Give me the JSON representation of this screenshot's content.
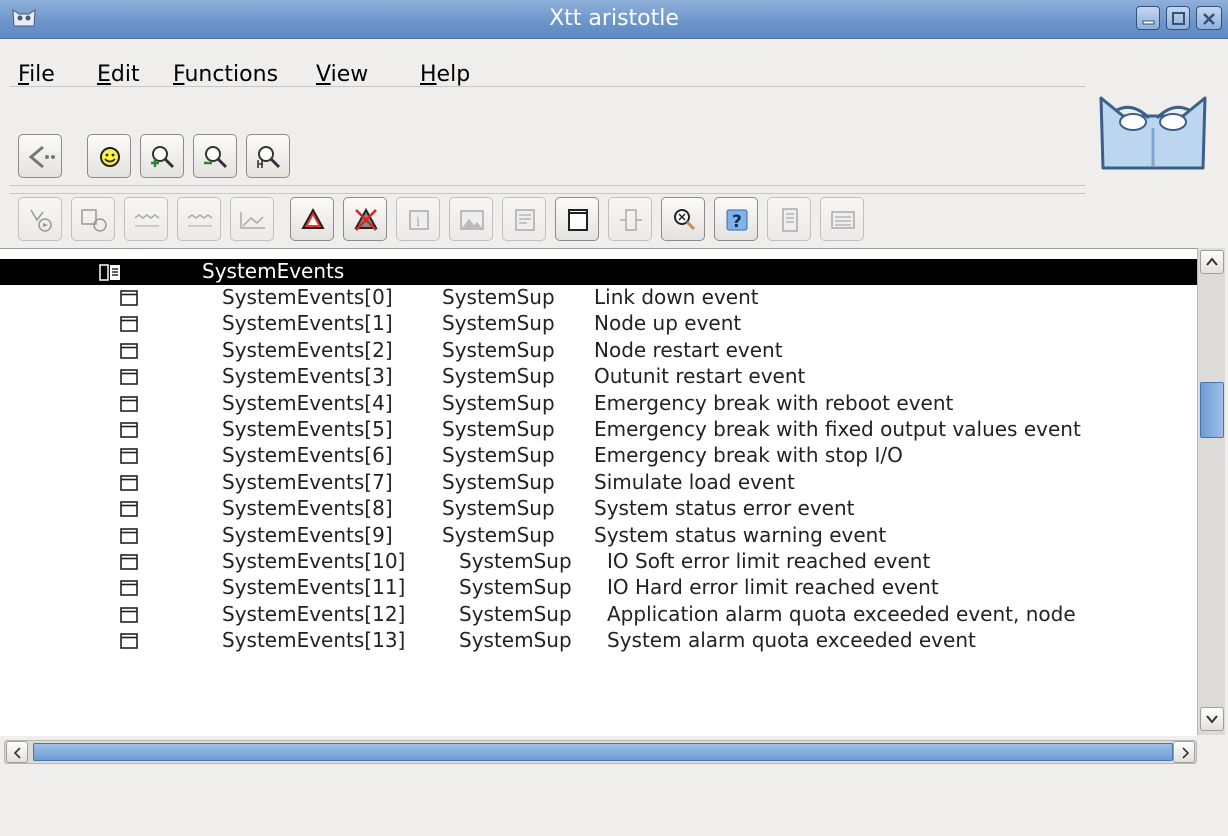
{
  "window": {
    "title": "Xtt aristotle"
  },
  "menu": [
    {
      "mnemonic": "F",
      "rest": "ile"
    },
    {
      "mnemonic": "E",
      "rest": "dit"
    },
    {
      "mnemonic": "F",
      "rest": "unctions"
    },
    {
      "mnemonic": "V",
      "rest": "iew"
    },
    {
      "mnemonic": "H",
      "rest": "elp"
    }
  ],
  "tree": {
    "parent": {
      "name": "SystemEvents"
    },
    "rows": [
      {
        "name": "SystemEvents[0]",
        "class": "SystemSup",
        "text": "Link down event"
      },
      {
        "name": "SystemEvents[1]",
        "class": "SystemSup",
        "text": "Node up event"
      },
      {
        "name": "SystemEvents[2]",
        "class": "SystemSup",
        "text": "Node restart event"
      },
      {
        "name": "SystemEvents[3]",
        "class": "SystemSup",
        "text": "Outunit restart event"
      },
      {
        "name": "SystemEvents[4]",
        "class": "SystemSup",
        "text": "Emergency break with reboot event"
      },
      {
        "name": "SystemEvents[5]",
        "class": "SystemSup",
        "text": "Emergency break with fixed output values event"
      },
      {
        "name": "SystemEvents[6]",
        "class": "SystemSup",
        "text": "Emergency break with stop I/O"
      },
      {
        "name": "SystemEvents[7]",
        "class": "SystemSup",
        "text": "Simulate load event"
      },
      {
        "name": "SystemEvents[8]",
        "class": "SystemSup",
        "text": "System status error event"
      },
      {
        "name": "SystemEvents[9]",
        "class": "SystemSup",
        "text": "System status warning event"
      },
      {
        "name": "SystemEvents[10]",
        "class": "SystemSup",
        "text": "IO Soft error limit reached event"
      },
      {
        "name": "SystemEvents[11]",
        "class": "SystemSup",
        "text": "IO Hard error limit reached event"
      },
      {
        "name": "SystemEvents[12]",
        "class": "SystemSup",
        "text": "Application alarm quota exceeded event, node"
      },
      {
        "name": "SystemEvents[13]",
        "class": "SystemSup",
        "text": "System alarm quota exceeded event"
      }
    ]
  },
  "colors": {
    "titlebar": "#6d96cb",
    "selection": "#000000",
    "scroll_thumb": "#6e9bd6"
  }
}
